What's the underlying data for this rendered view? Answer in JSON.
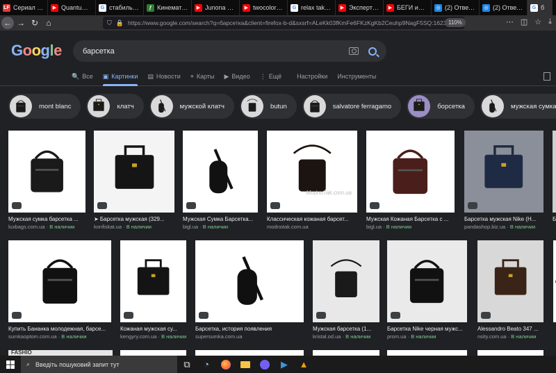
{
  "browser": {
    "tabs": [
      {
        "label": "Сериал Клин",
        "color": "#e53935",
        "glyph": "LF"
      },
      {
        "label": "Quantum Ga",
        "color": "#ff0000",
        "glyph": "▶"
      },
      {
        "label": "стабильная",
        "color": "#ffffff",
        "glyph": "G"
      },
      {
        "label": "Кинематогр",
        "color": "#2e7d32",
        "glyph": "ƒ"
      },
      {
        "label": "Junona Boys",
        "color": "#ff0000",
        "glyph": "▶"
      },
      {
        "label": "twocolors - L",
        "color": "#ff0000",
        "glyph": "▶"
      },
      {
        "label": "relax take it e",
        "color": "#ffffff",
        "glyph": "G"
      },
      {
        "label": "Эксперт (Кор",
        "color": "#ff0000",
        "glyph": "▶"
      },
      {
        "label": "БЕГИ или УМ",
        "color": "#ff0000",
        "glyph": "▶"
      },
      {
        "label": "(2) Ответы М",
        "color": "#1e88e5",
        "glyph": "◎"
      },
      {
        "label": "(2) Ответы М",
        "color": "#1e88e5",
        "glyph": "◎"
      },
      {
        "label": "б",
        "color": "#ffffff",
        "glyph": "G"
      }
    ],
    "url": "https://www.google.com/search?q=барсетка&client=firefox-b-d&sxsrf=ALeKk03fKmFe6FKzKgKb2Ceuhp9NagF5SQ:1623",
    "zoom": "110%"
  },
  "google": {
    "logo": "Google",
    "logo_colors": [
      "#8ab4f8",
      "#f28b82",
      "#fdd663",
      "#8ab4f8",
      "#81c995",
      "#f28b82"
    ],
    "query": "барсетка",
    "tabs": [
      {
        "label": "Все",
        "icon": "🔍"
      },
      {
        "label": "Картинки",
        "icon": "▣"
      },
      {
        "label": "Новости",
        "icon": "▤"
      },
      {
        "label": "Карты",
        "icon": "⌖"
      },
      {
        "label": "Видео",
        "icon": "▶"
      },
      {
        "label": "Ещё",
        "icon": "⋮"
      }
    ],
    "tools": [
      "Настройки",
      "Инструменты"
    ],
    "chips": [
      "mont blanc",
      "клатч",
      "мужской клатч",
      "butun",
      "salvatore ferragamo",
      "борсетка",
      "мужская сумка барсе"
    ],
    "results_row1": [
      {
        "title": "Мужская сумка барсетка ...",
        "source": "luxbags.com.ua",
        "status": "В наличии",
        "bg": "#ffffff",
        "fg": "#1a1a1a"
      },
      {
        "title": "➤ Барсетка мужская (329...",
        "source": "konfiskat.ua",
        "status": "В наличии",
        "bg": "#f4f4f4",
        "fg": "#151515"
      },
      {
        "title": "Мужская Сумка Барсетка...",
        "source": "bigl.ua",
        "status": "В наличии",
        "bg": "#ffffff",
        "fg": "#111111"
      },
      {
        "title": "Классическая кожаная барсет...",
        "source": "modnotak.com.ua",
        "status": "",
        "bg": "#ffffff",
        "fg": "#1c1410"
      },
      {
        "title": "Мужская Кожаная Барсетка с ...",
        "source": "bigl.ua",
        "status": "В наличии",
        "bg": "#ffffff",
        "fg": "#4a1e1a"
      },
      {
        "title": "Барсетка мужская Nike (Н...",
        "source": "pandashop.biz.ua",
        "status": "В наличии",
        "bg": "#8a8f99",
        "fg": "#1f2a44"
      },
      {
        "title": "Б",
        "source": "",
        "status": "",
        "bg": "#cfcfcf",
        "fg": "#222222"
      }
    ],
    "watermark": "ModnoTak.com.ua",
    "results_row2": [
      {
        "title": "Купить Бананка молодежная, барсе...",
        "source": "sumkaoptom.com.ua",
        "status": "В наличии",
        "bg": "#ffffff",
        "fg": "#111111"
      },
      {
        "title": "Кожаная мужская су...",
        "source": "kengyry.com.ua",
        "status": "В наличии",
        "bg": "#ffffff",
        "fg": "#141414"
      },
      {
        "title": "Барсетка, история появления",
        "source": "supersumka.com.ua",
        "status": "",
        "bg": "#ffffff",
        "fg": "#101010"
      },
      {
        "title": "Мужская барсетка (1...",
        "source": "kristal.od.ua",
        "status": "В наличии",
        "bg": "#e8e8e8",
        "fg": "#1a1a1a"
      },
      {
        "title": "Барсетка Nike черная мужс...",
        "source": "prom.ua",
        "status": "В наличии",
        "bg": "#eaeaea",
        "fg": "#111111"
      },
      {
        "title": "Alessandro Beato 347 ...",
        "source": "nsity.com.ua",
        "status": "В наличии",
        "bg": "#d8d8d8",
        "fg": "#3a2418"
      },
      {
        "title": "",
        "source": "",
        "status": "",
        "bg": "#ffffff",
        "fg": "#222222"
      }
    ],
    "row3_text": "FASHIO"
  },
  "taskbar": {
    "search_placeholder": "Введіть пошуковий запит тут",
    "icons": [
      "task-view-icon",
      "nav-app-icon",
      "firefox-icon",
      "file-explorer-icon",
      "viber-icon",
      "media-player-icon",
      "vlc-icon"
    ]
  }
}
